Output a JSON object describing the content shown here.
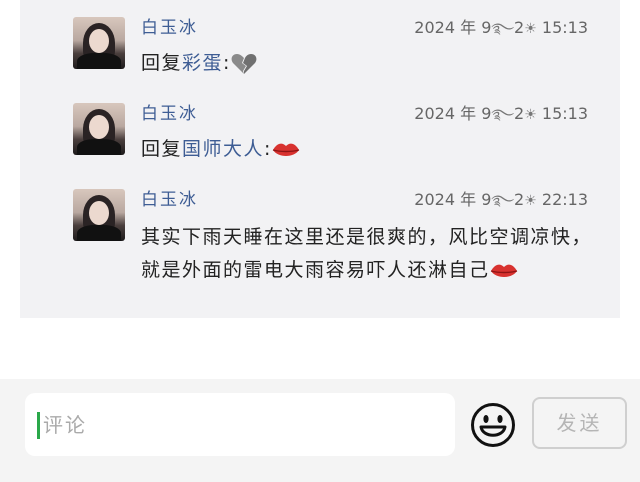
{
  "comments": [
    {
      "username": "白玉冰",
      "date_prefix": "2024 年 9",
      "date_mid": "2",
      "clock": "15:13",
      "reply_prefix": "回复",
      "mention": "彩蛋",
      "separator": ":",
      "emoji": "broken-heart",
      "text": ""
    },
    {
      "username": "白玉冰",
      "date_prefix": "2024 年 9",
      "date_mid": "2",
      "clock": "15:13",
      "reply_prefix": "回复",
      "mention": "国师大人",
      "separator": ":",
      "emoji": "lips",
      "text": ""
    },
    {
      "username": "白玉冰",
      "date_prefix": "2024 年 9",
      "date_mid": "2",
      "clock": "22:13",
      "reply_prefix": "",
      "mention": "",
      "separator": "",
      "emoji": "lips",
      "text": "其实下雨天睡在这里还是很爽的，风比空调凉快，就是外面的雷电大雨容易吓人还淋自己"
    }
  ],
  "date_glyphs": [
    "cloud-spiral-icon",
    "sun-icon"
  ],
  "composer": {
    "placeholder": "评论",
    "emoji_button_icon": "smiley-icon",
    "send_label": "发送"
  },
  "colors": {
    "username": "#3e5d94",
    "panel_bg": "#f2f2f4",
    "cursor": "#2aa84a",
    "lips": "#d8322f",
    "broken_heart": "#8a8a8a"
  }
}
